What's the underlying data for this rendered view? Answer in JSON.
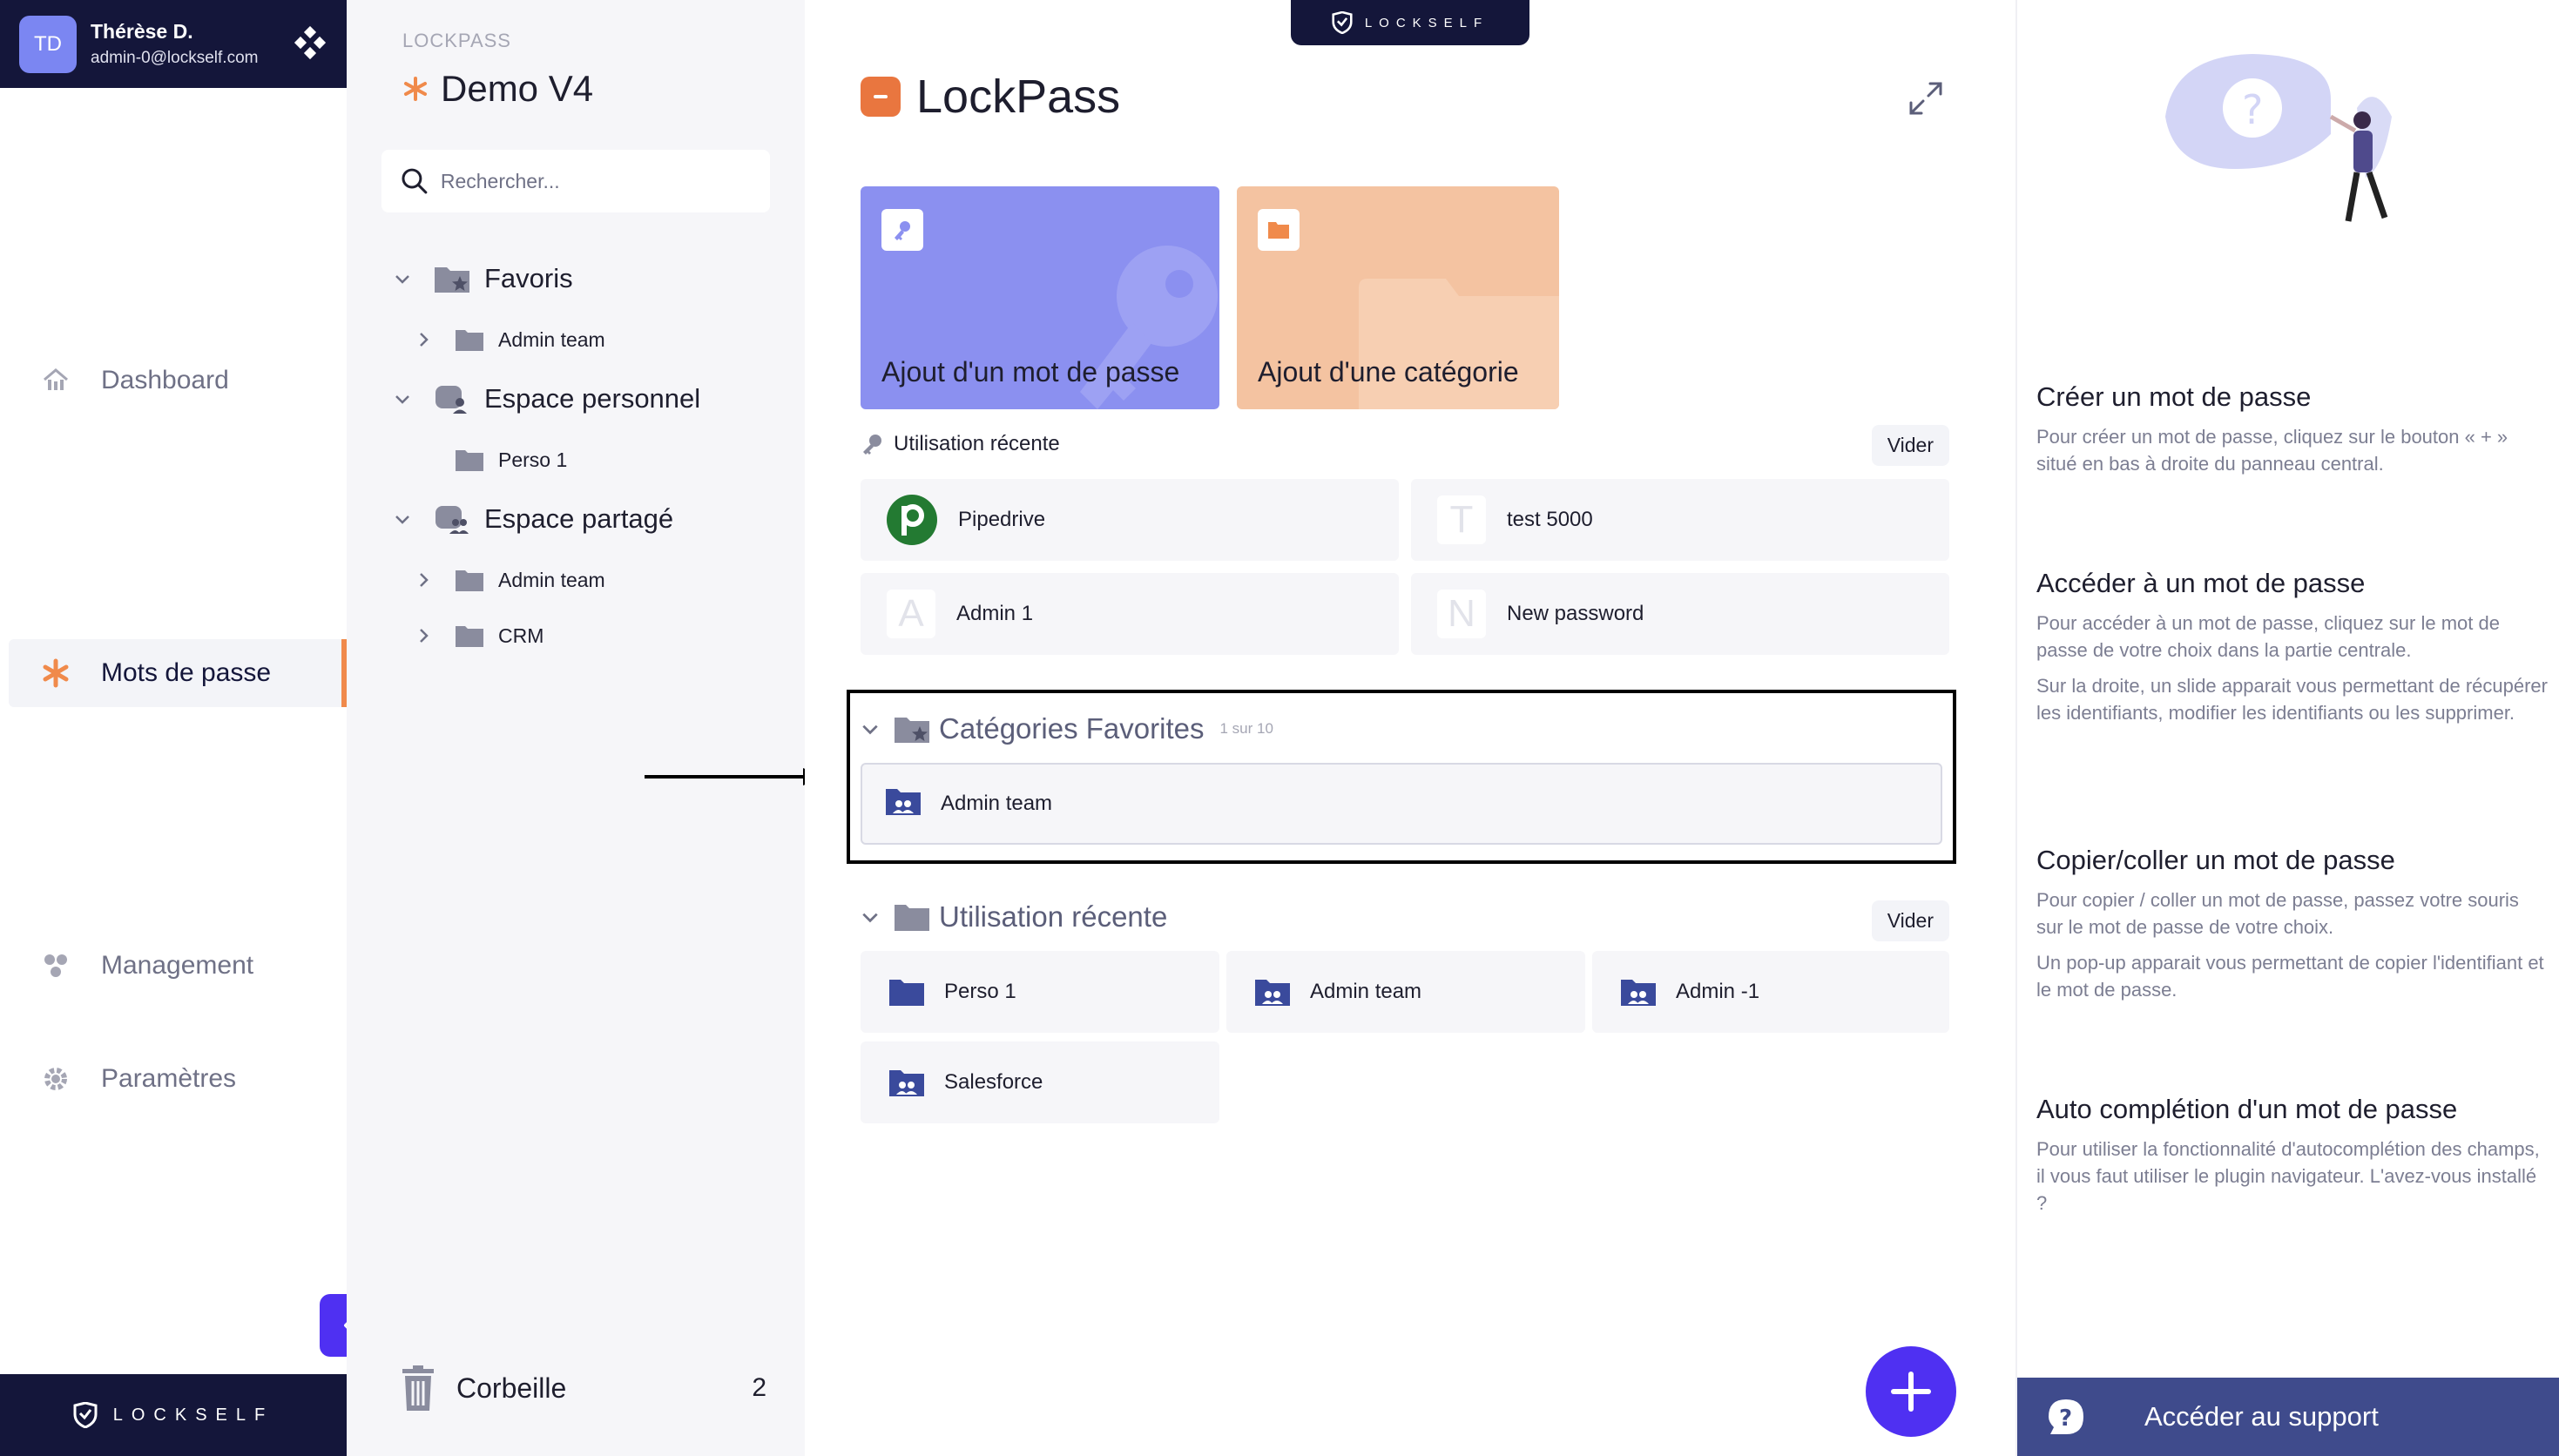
{
  "user": {
    "initials": "TD",
    "name": "Thérèse D.",
    "email": "admin-0@lockself.com"
  },
  "nav": {
    "items": [
      {
        "label": "Dashboard",
        "icon": "home-icon"
      },
      {
        "label": "Mots de passe",
        "icon": "star-icon",
        "active": true
      },
      {
        "label": "Management",
        "icon": "team-icon"
      },
      {
        "label": "Paramètres",
        "icon": "gear-icon"
      }
    ],
    "brand": "LOCKSELF"
  },
  "tree": {
    "section": "LOCKPASS",
    "title": "Demo V4",
    "search_placeholder": "Rechercher...",
    "favoris": {
      "label": "Favoris",
      "children": [
        "Admin team"
      ]
    },
    "personnel": {
      "label": "Espace personnel",
      "children": [
        "Perso 1"
      ]
    },
    "partage": {
      "label": "Espace partagé",
      "children": [
        "Admin team",
        "CRM"
      ]
    },
    "trash": {
      "label": "Corbeille",
      "count": "2"
    }
  },
  "main": {
    "badge": "LOCKSELF",
    "title": "LockPass",
    "tiles": {
      "password": "Ajout d'un mot de passe",
      "category": "Ajout d'une catégorie"
    },
    "recent_pw": {
      "label": "Utilisation récente",
      "clear": "Vider",
      "items": [
        {
          "name": "Pipedrive",
          "letter": "P"
        },
        {
          "name": "test 5000",
          "letter": "T"
        },
        {
          "name": "Admin 1",
          "letter": "A"
        },
        {
          "name": "New password",
          "letter": "N"
        }
      ]
    },
    "fav_cats": {
      "label": "Catégories Favorites",
      "pager": "1 sur 10",
      "items": [
        "Admin team"
      ]
    },
    "recent_cats": {
      "label": "Utilisation récente",
      "clear": "Vider",
      "items": [
        "Perso 1",
        "Admin team",
        "Admin -1",
        "Salesforce"
      ]
    }
  },
  "help": {
    "blocks": [
      {
        "title": "Créer un mot de passe",
        "paras": [
          "Pour créer un mot de passe, cliquez sur le bouton « + » situé en bas à droite du panneau central."
        ]
      },
      {
        "title": "Accéder à un mot de passe",
        "paras": [
          "Pour accéder à un mot de passe, cliquez sur le mot de passe de votre choix dans la partie centrale.",
          "Sur la droite, un slide apparait vous permettant de récupérer les identifiants, modifier les identifiants ou les supprimer."
        ]
      },
      {
        "title": "Copier/coller un mot de passe",
        "paras": [
          "Pour copier / coller un mot de passe, passez votre souris sur le mot de passe de votre choix.",
          "Un pop-up apparait vous permettant de copier l'identifiant et le mot de passe."
        ]
      },
      {
        "title": "Auto complétion d'un mot de passe",
        "paras": [
          "Pour utiliser la fonctionnalité d'autocomplétion des champs, il vous faut utiliser le plugin navigateur. L'avez-vous installé ?"
        ]
      }
    ],
    "support": "Accéder au support"
  },
  "colors": {
    "navy": "#14163a",
    "accent": "#4f30f2",
    "orange": "#f08a4b",
    "tile_pw": "#8b90f0",
    "tile_cat": "#f4c3a1"
  }
}
